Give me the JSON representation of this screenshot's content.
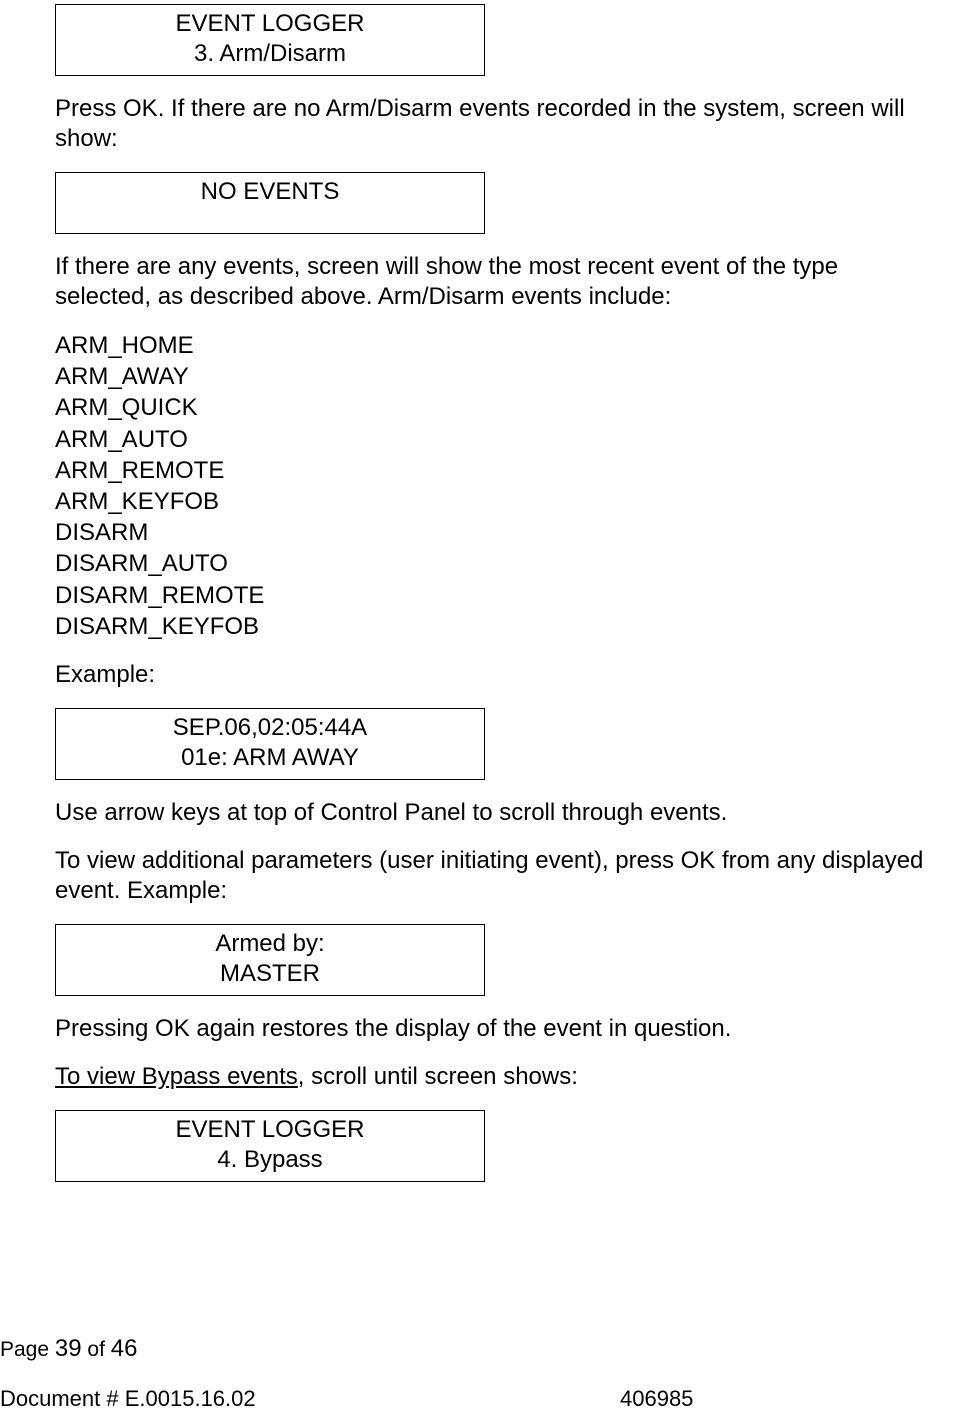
{
  "box1": {
    "line1": "EVENT LOGGER",
    "line2": "3. Arm/Disarm"
  },
  "para1": "Press OK. If there are no Arm/Disarm events recorded in the system, screen will show:",
  "box2": {
    "line1": "NO EVENTS"
  },
  "para2": "If there are any events, screen will show the most recent event of the type selected, as described above. Arm/Disarm events include:",
  "events": [
    "ARM_HOME",
    "ARM_AWAY",
    "ARM_QUICK",
    "ARM_AUTO",
    "ARM_REMOTE",
    "ARM_KEYFOB",
    "DISARM",
    "DISARM_AUTO",
    "DISARM_REMOTE",
    "DISARM_KEYFOB"
  ],
  "example_label": "Example:",
  "box3": {
    "line1": "SEP.06,02:05:44A",
    "line2": "01e: ARM AWAY"
  },
  "para3": "Use arrow keys at top of Control Panel to scroll through events.",
  "para4": "To view additional parameters (user initiating event), press OK from any displayed event. Example:",
  "box4": {
    "line1": "Armed by:",
    "line2": "MASTER"
  },
  "para5": "Pressing OK again restores the display of the event in question.",
  "para6_underline": "To view Bypass events",
  "para6_rest": ", scroll until screen shows:",
  "box5": {
    "line1": "EVENT LOGGER",
    "line2": "4. Bypass"
  },
  "footer": {
    "page_label": "Page ",
    "page_current": "39",
    "page_of": "  of   ",
    "page_total": "46",
    "doc_label": "Document # E.0015.16.02",
    "doc_right": "406985"
  }
}
